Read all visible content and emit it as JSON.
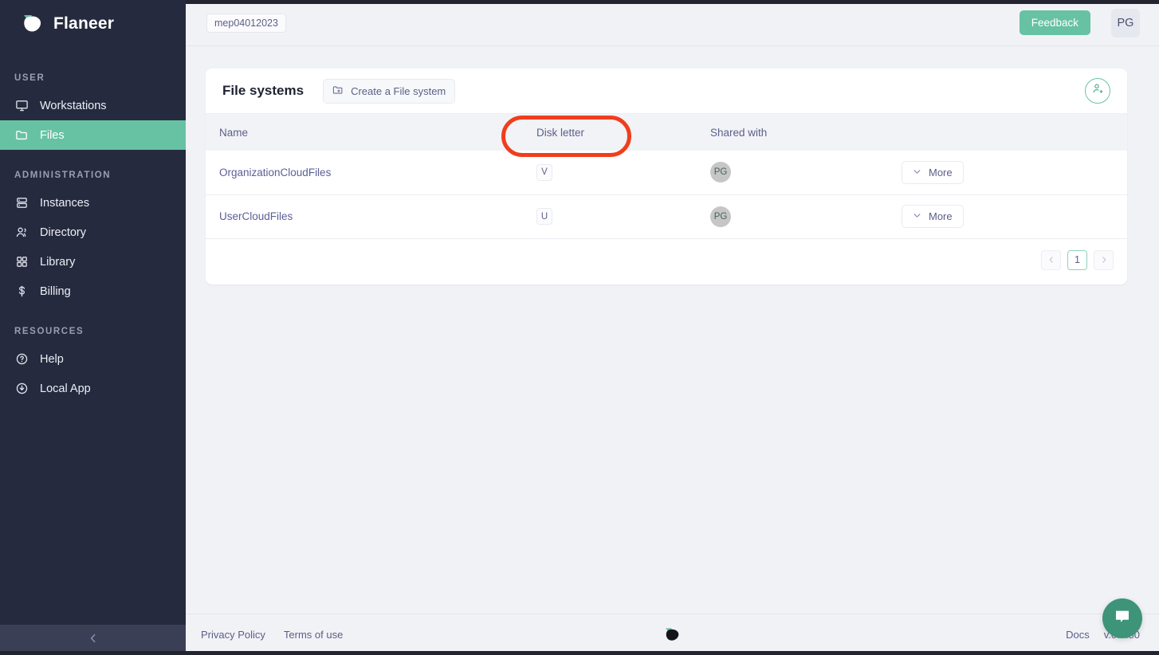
{
  "brand": {
    "name": "Flaneer",
    "logo_icon": "flaneer-logo-icon"
  },
  "sidebar": {
    "sections": [
      {
        "label": "USER",
        "items": [
          {
            "label": "Workstations",
            "icon": "monitor-icon",
            "active": false
          },
          {
            "label": "Files",
            "icon": "folder-icon",
            "active": true
          }
        ]
      },
      {
        "label": "ADMINISTRATION",
        "items": [
          {
            "label": "Instances",
            "icon": "server-icon",
            "active": false
          },
          {
            "label": "Directory",
            "icon": "users-icon",
            "active": false
          },
          {
            "label": "Library",
            "icon": "grid-icon",
            "active": false
          },
          {
            "label": "Billing",
            "icon": "dollar-icon",
            "active": false
          }
        ]
      },
      {
        "label": "RESOURCES",
        "items": [
          {
            "label": "Help",
            "icon": "question-circle-icon",
            "active": false
          },
          {
            "label": "Local App",
            "icon": "download-circle-icon",
            "active": false
          }
        ]
      }
    ],
    "collapse_icon": "chevron-left-icon"
  },
  "topbar": {
    "org_chip": "mep04012023",
    "feedback_label": "Feedback",
    "user_initials": "PG"
  },
  "card": {
    "title": "File systems",
    "create_label": "Create a File system",
    "create_icon": "folder-plus-icon",
    "share_icon": "user-plus-icon",
    "columns": [
      "Name",
      "Disk letter",
      "Shared with",
      ""
    ],
    "rows": [
      {
        "name": "OrganizationCloudFiles",
        "disk_letter": "V",
        "shared_with": "PG",
        "action_label": "More",
        "action_icon": "chevron-down-icon"
      },
      {
        "name": "UserCloudFiles",
        "disk_letter": "U",
        "shared_with": "PG",
        "action_label": "More",
        "action_icon": "chevron-down-icon"
      }
    ],
    "pagination": {
      "prev_icon": "chevron-left-icon",
      "next_icon": "chevron-right-icon",
      "pages": [
        "1"
      ],
      "current_page": "1"
    }
  },
  "footer": {
    "privacy_label": "Privacy Policy",
    "terms_label": "Terms of use",
    "docs_label": "Docs",
    "version_label": "v.0.9.80",
    "logo_icon": "flaneer-mark-icon",
    "chat_icon": "chat-bubble-icon"
  },
  "annotation": {
    "type": "red-oval-highlight",
    "target": "create-file-system-button",
    "color": "#f03e1d"
  },
  "colors": {
    "sidebar_bg": "#262a3e",
    "accent_green": "#66c2a3",
    "page_bg": "#f1f2f6",
    "text_muted": "#5c6088",
    "chat_fab": "#3d9479"
  }
}
